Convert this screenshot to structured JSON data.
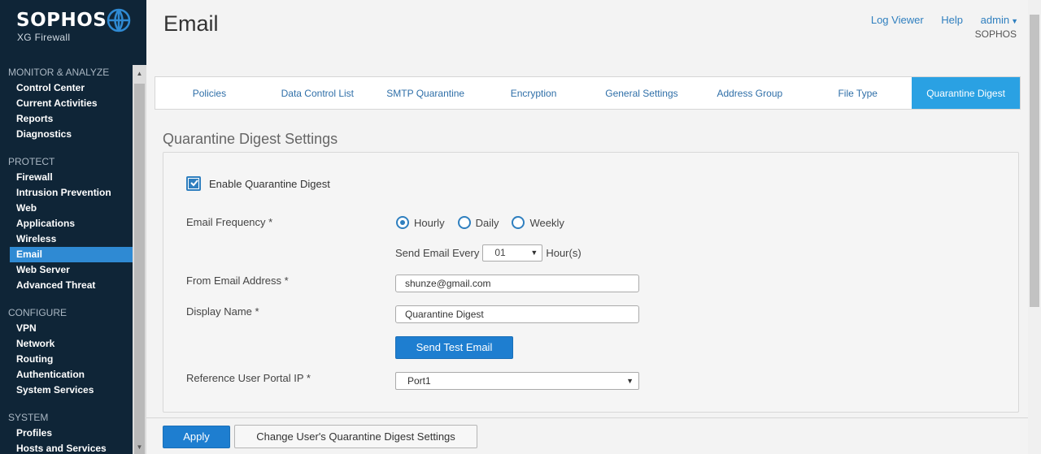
{
  "brand": {
    "name": "SOPHOS",
    "product": "XG Firewall"
  },
  "nav": [
    {
      "section": "MONITOR & ANALYZE",
      "items": [
        "Control Center",
        "Current Activities",
        "Reports",
        "Diagnostics"
      ]
    },
    {
      "section": "PROTECT",
      "items": [
        "Firewall",
        "Intrusion Prevention",
        "Web",
        "Applications",
        "Wireless",
        "Email",
        "Web Server",
        "Advanced Threat"
      ]
    },
    {
      "section": "CONFIGURE",
      "items": [
        "VPN",
        "Network",
        "Routing",
        "Authentication",
        "System Services"
      ]
    },
    {
      "section": "SYSTEM",
      "items": [
        "Profiles",
        "Hosts and Services"
      ]
    }
  ],
  "active_nav": "Email",
  "header": {
    "title": "Email",
    "links": {
      "log_viewer": "Log Viewer",
      "help": "Help",
      "user": "admin"
    },
    "org": "SOPHOS"
  },
  "tabs": [
    "Policies",
    "Data Control List",
    "SMTP Quarantine",
    "Encryption",
    "General Settings",
    "Address Group",
    "File Type",
    "Quarantine Digest"
  ],
  "active_tab": "Quarantine Digest",
  "settings": {
    "section_title": "Quarantine Digest Settings",
    "enable_label": "Enable Quarantine Digest",
    "enable_checked": true,
    "frequency_label": "Email Frequency *",
    "frequency_options": [
      "Hourly",
      "Daily",
      "Weekly"
    ],
    "frequency_selected": "Hourly",
    "send_every_label": "Send Email Every",
    "send_every_value": "01",
    "send_every_unit": "Hour(s)",
    "from_label": "From Email Address *",
    "from_value": "shunze@gmail.com",
    "display_name_label": "Display Name *",
    "display_name_value": "Quarantine Digest",
    "send_test_label": "Send Test Email",
    "portal_ip_label": "Reference User Portal IP *",
    "portal_ip_value": "Port1"
  },
  "footer": {
    "apply": "Apply",
    "change_user": "Change User's Quarantine Digest Settings"
  },
  "colors": {
    "sidebar_bg": "#0f2537",
    "accent": "#2aa1e3",
    "primary_button": "#1e7ed0",
    "active_nav": "#2f8ad3"
  }
}
